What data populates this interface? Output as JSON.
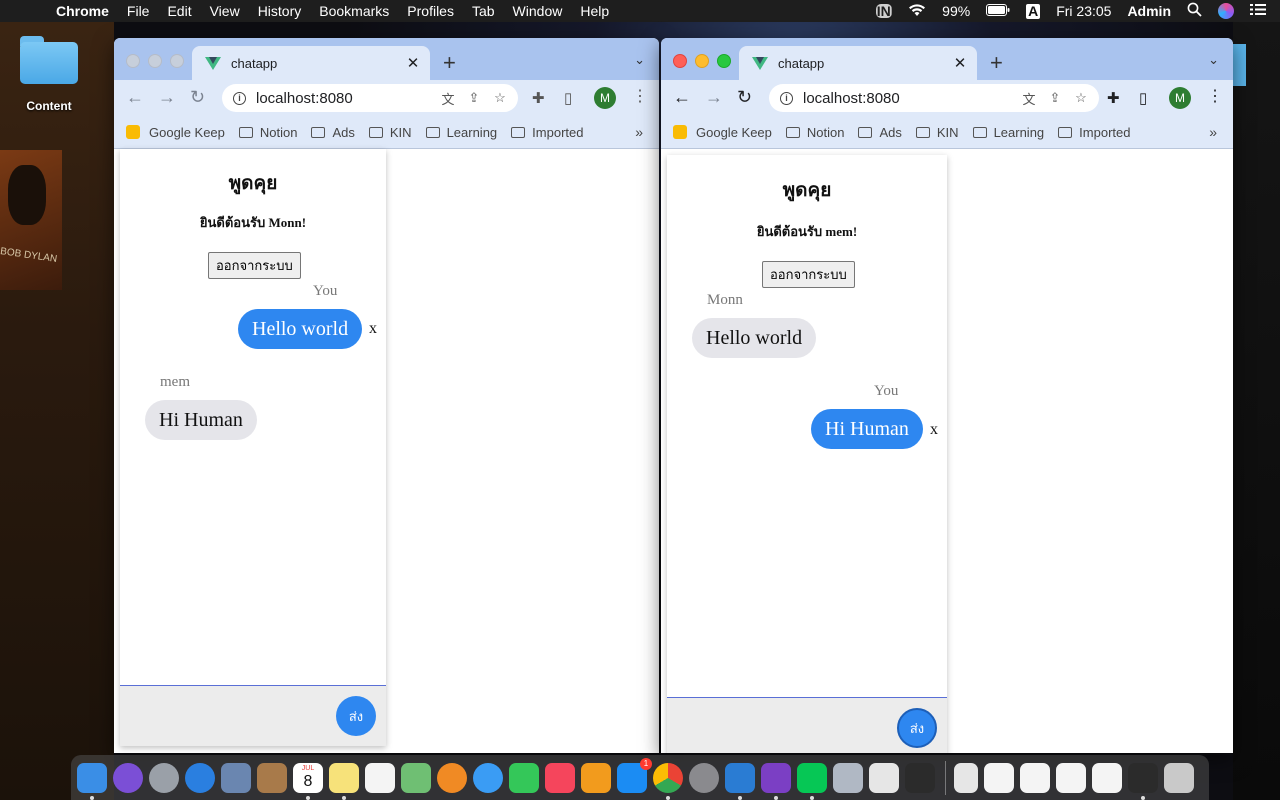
{
  "menubar": {
    "app": "Chrome",
    "items": [
      "File",
      "Edit",
      "View",
      "History",
      "Bookmarks",
      "Profiles",
      "Tab",
      "Window",
      "Help"
    ],
    "battery": "99%",
    "input_source": "A",
    "clock": "Fri 23:05",
    "user": "Admin",
    "line_badge": "LINE"
  },
  "desktop": {
    "folder_label": "Content",
    "poster_text": "BOB DYLAN"
  },
  "browser": {
    "tab_title": "chatapp",
    "url": "localhost:8080",
    "avatar_letter": "M",
    "bookmarks": [
      "Google Keep",
      "Notion",
      "Ads",
      "KIN",
      "Learning",
      "Imported"
    ],
    "bookmarks_more": "»"
  },
  "windows": [
    {
      "title": "พูดคุย",
      "welcome": "ยินดีต้อนรับ Monn!",
      "logout": "ออกจากระบบ",
      "messages": [
        {
          "sender": "You",
          "text": "Hello world",
          "mine": true,
          "delete": "x"
        },
        {
          "sender": "mem",
          "text": "Hi Human",
          "mine": false
        }
      ],
      "send": "ส่ง"
    },
    {
      "title": "พูดคุย",
      "welcome": "ยินดีต้อนรับ mem!",
      "logout": "ออกจากระบบ",
      "messages": [
        {
          "sender": "Monn",
          "text": "Hello world",
          "mine": false
        },
        {
          "sender": "You",
          "text": "Hi Human",
          "mine": true,
          "delete": "x"
        }
      ],
      "send": "ส่ง"
    }
  ],
  "dock": {
    "calendar_month": "JUL",
    "calendar_day": "8",
    "appstore_badge": "1",
    "colors": {
      "finder": "#3a8ee6",
      "siri": "#7b4fd6",
      "launchpad": "#9aa0a8",
      "safari": "#2a7fe0",
      "preview": "#6a86b0",
      "notes_brown": "#a87a4a",
      "calendar": "#ffffff",
      "notes": "#f7e27a",
      "reminders": "#f4f4f4",
      "maps": "#6fbf73",
      "photos": "#f08a24",
      "messages": "#3a9cf4",
      "facetime": "#34c759",
      "music": "#f5455c",
      "books": "#f29b1d",
      "appstore": "#1b8cf3",
      "chrome": "#e8e8e8",
      "settings": "#8a8a8e",
      "vscode": "#2a7cd3",
      "github": "#7b3fc4",
      "line": "#06c755",
      "utility": "#b0b8c4",
      "textedit": "#e6e6e6",
      "terminal": "#2b2b2b",
      "trash": "#c9c9c9"
    }
  }
}
